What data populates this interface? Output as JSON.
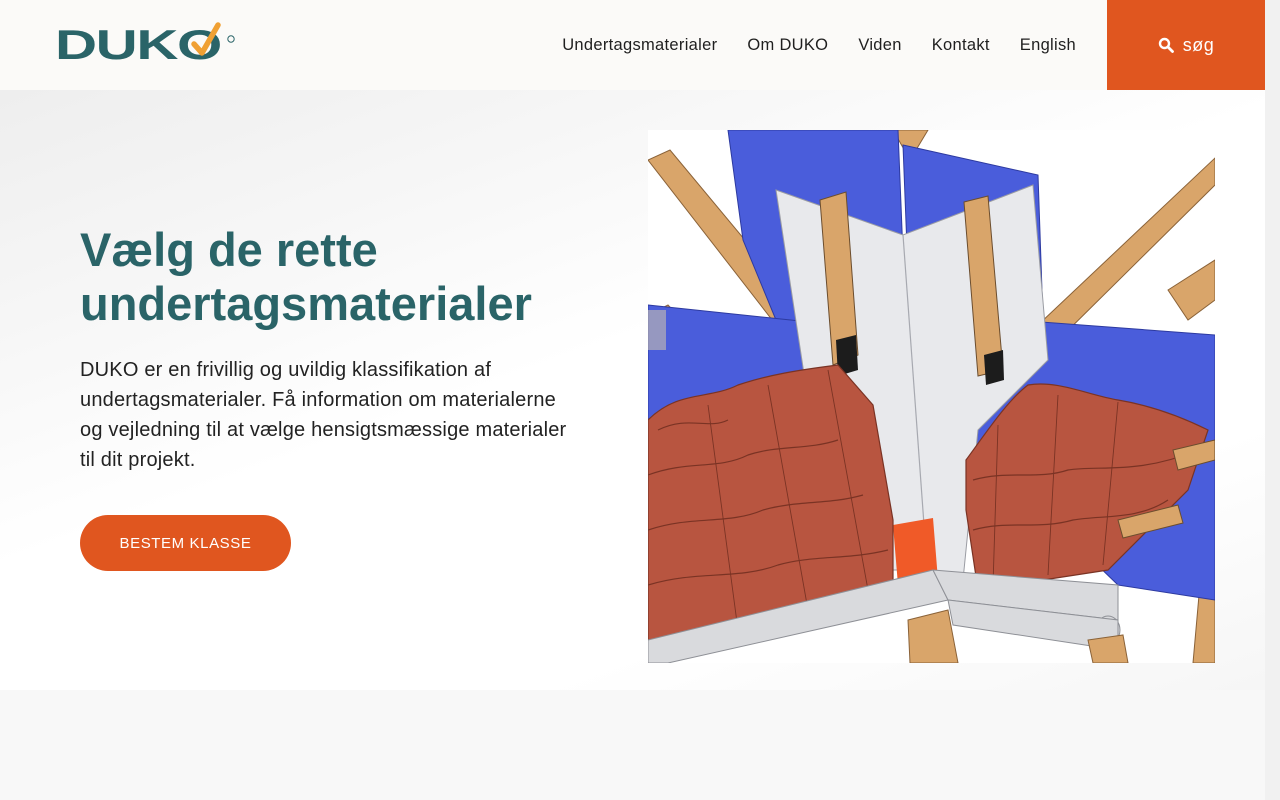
{
  "header": {
    "logo_text": "DUKO",
    "nav": [
      {
        "label": "Undertagsmaterialer"
      },
      {
        "label": "Om DUKO"
      },
      {
        "label": "Viden"
      },
      {
        "label": "Kontakt"
      },
      {
        "label": "English"
      }
    ],
    "search_label": "søg",
    "search_icon": "search-icon"
  },
  "hero": {
    "title": "Vælg de rette undertagsmaterialer",
    "text": "DUKO er en frivillig og uvildig klassifikation af undertagsmaterialer. Få information om materialerne og vejledning til at vælge hensigtsmæssige materialer til dit projekt.",
    "cta_label": "BESTEM KLASSE",
    "image_subject": "roof-valley-illustration"
  },
  "colors": {
    "brand_teal": "#2a6468",
    "accent_orange": "#e0561f",
    "check_orange": "#f0a033",
    "membrane_blue": "#4a5ddb",
    "tile_red": "#b85540",
    "timber": "#d9a56a"
  }
}
